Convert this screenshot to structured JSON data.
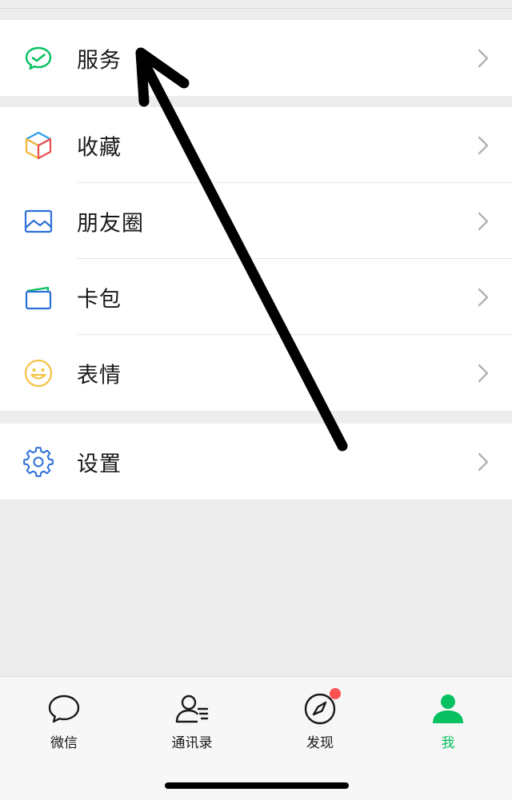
{
  "menu": {
    "group1": [
      {
        "id": "services",
        "label": "服务",
        "icon": "wechat-pay-icon"
      }
    ],
    "group2": [
      {
        "id": "favorites",
        "label": "收藏",
        "icon": "cube-icon"
      },
      {
        "id": "moments",
        "label": "朋友圈",
        "icon": "image-icon"
      },
      {
        "id": "cards",
        "label": "卡包",
        "icon": "card-wallet-icon"
      },
      {
        "id": "stickers",
        "label": "表情",
        "icon": "smiley-icon"
      }
    ],
    "group3": [
      {
        "id": "settings",
        "label": "设置",
        "icon": "gear-icon"
      }
    ]
  },
  "tabbar": {
    "tabs": [
      {
        "id": "chats",
        "label": "微信",
        "icon": "chat-bubble-icon",
        "active": false
      },
      {
        "id": "contacts",
        "label": "通讯录",
        "icon": "contacts-icon",
        "active": false
      },
      {
        "id": "discover",
        "label": "发现",
        "icon": "compass-icon",
        "active": false,
        "badge": true
      },
      {
        "id": "me",
        "label": "我",
        "icon": "person-icon",
        "active": true
      }
    ]
  },
  "colors": {
    "active_tab": "#07c160",
    "badge": "#fa5151",
    "background": "#ededed"
  },
  "overlay": {
    "annotation": "hand-drawn-arrow-pointing-to-services"
  }
}
